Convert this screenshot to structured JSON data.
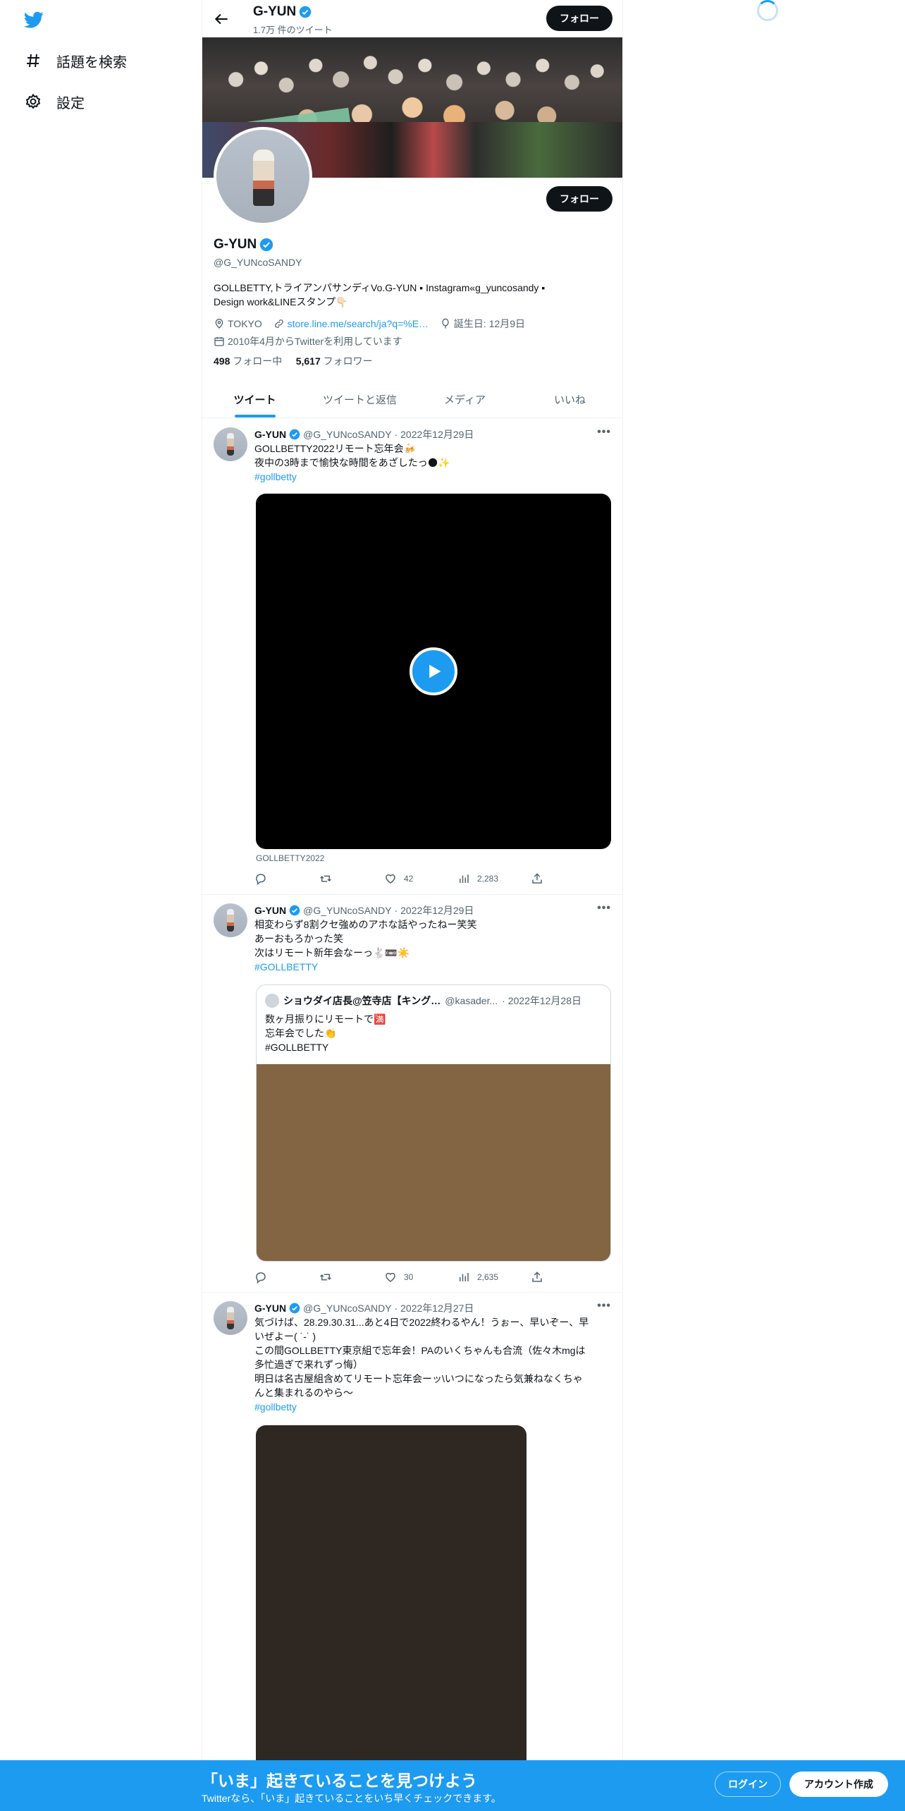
{
  "nav": {
    "explore_label": "話題を検索",
    "settings_label": "設定"
  },
  "topbar": {
    "name": "G-YUN",
    "tweet_count": "1.7万 件のツイート",
    "follow_label": "フォロー"
  },
  "profile": {
    "name": "G-YUN",
    "handle": "@G_YUNcoSANDY",
    "follow_label": "フォロー",
    "bio_line1": "GOLLBETTY,トライアンパサンディVo.G-YUN ▪︎ Instagram«g_yuncosandy ▪︎",
    "bio_line2": "Design work&LINEスタンプ👇🏻",
    "location": "TOKYO",
    "link": "store.line.me/search/ja?q=%E…",
    "birthday": "誕生日: 12月9日",
    "joined": "2010年4月からTwitterを利用しています",
    "following_count": "498",
    "following_label": "フォロー中",
    "followers_count": "5,617",
    "followers_label": "フォロワー"
  },
  "tabs": [
    "ツイート",
    "ツイートと返信",
    "メディア",
    "いいね"
  ],
  "tweets": [
    {
      "name": "G-YUN",
      "handle": "@G_YUNcoSANDY",
      "date": "· 2022年12月29日",
      "lines": [
        "GOLLBETTY2022リモート忘年会🍻",
        "夜中の3時まで愉快な時間をあざしたっ🌑✨"
      ],
      "hashtag": "#gollbetty",
      "caption": "GOLLBETTY2022",
      "likes": "42",
      "views": "2,283"
    },
    {
      "name": "G-YUN",
      "handle": "@G_YUNcoSANDY",
      "date": "· 2022年12月29日",
      "lines": [
        "相変わらず8割クセ強めのアホな話やったねー笑笑",
        "あーおもろかった笑",
        "次はリモート新年会なーっ🐇📼☀️"
      ],
      "hashtag": "#GOLLBETTY",
      "quote": {
        "name": "ショウダイ店長@笠寺店【キング…",
        "handle": "@kasader...",
        "date": "· 2022年12月28日",
        "lines": [
          "数ヶ月振りにリモートで🈵",
          "忘年会でした👏",
          "#GOLLBETTY"
        ]
      },
      "likes": "30",
      "views": "2,635"
    },
    {
      "name": "G-YUN",
      "handle": "@G_YUNcoSANDY",
      "date": "· 2022年12月27日",
      "lines": [
        "気づけば、28.29.30.31...あと4日で2022終わるやん！うぉー、早いぞー、早",
        "いぜよー(  ˙-˙  )",
        "この間GOLLBETTY東京組で忘年会！PAのいくちゃんも合流（佐々木mgは",
        "多忙過ぎで来れずっ悔）",
        "明日は名古屋組含めてリモート忘年会ーッ\\いつになったら気兼ねなくちゃ",
        "んと集まれるのやら〜"
      ],
      "hashtag": "#gollbetty"
    }
  ],
  "bottom_bar": {
    "title": "「いま」起きていることを見つけよう",
    "subtitle": "Twitterなら、「いま」起きていることをいち早くチェックできます。",
    "login_label": "ログイン",
    "signup_label": "アカウント作成"
  },
  "colors": {
    "accent": "#1d9bf0",
    "text": "#0f1419",
    "secondary": "#536471"
  }
}
